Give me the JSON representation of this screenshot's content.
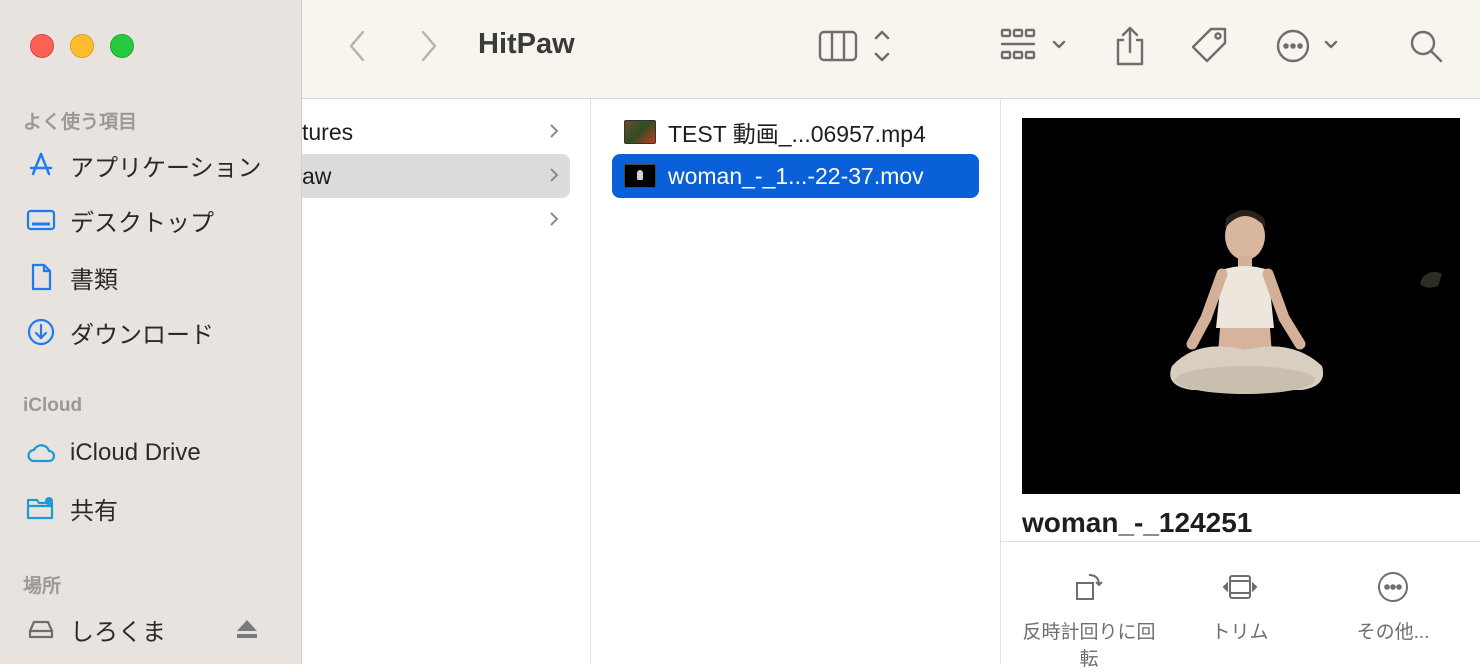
{
  "window": {
    "title": "HitPaw"
  },
  "sidebar": {
    "favorites_header": "よく使う項目",
    "favorites": [
      {
        "label": "アプリケーション",
        "icon": "applications-icon"
      },
      {
        "label": "デスクトップ",
        "icon": "desktop-icon"
      },
      {
        "label": "書類",
        "icon": "document-icon"
      },
      {
        "label": "ダウンロード",
        "icon": "download-icon"
      }
    ],
    "icloud_header": "iCloud",
    "icloud": [
      {
        "label": "iCloud Drive",
        "icon": "cloud-icon"
      },
      {
        "label": "共有",
        "icon": "shared-folder-icon"
      }
    ],
    "locations_header": "場所",
    "locations": [
      {
        "label": "しろくま",
        "icon": "disk-icon"
      }
    ]
  },
  "columns": {
    "parent": [
      {
        "label": "tures",
        "selected": false
      },
      {
        "label": "aw",
        "selected": true
      },
      {
        "label": "",
        "selected": false
      }
    ],
    "files": [
      {
        "label": "TEST 動画_...06957.mp4",
        "selected": false
      },
      {
        "label": "woman_-_1...-22-37.mov",
        "selected": true
      }
    ]
  },
  "preview": {
    "name": "woman_-_124251",
    "actions": [
      {
        "label": "反時計回りに回転",
        "icon": "rotate-left-icon"
      },
      {
        "label": "トリム",
        "icon": "trim-icon"
      },
      {
        "label": "その他...",
        "icon": "more-icon"
      }
    ]
  },
  "colors": {
    "selection": "#0a60d8",
    "sidebar_bg": "#e8e3de",
    "toolbar_bg": "#f8f4ee",
    "accent_icon": "#1b7cf2"
  }
}
